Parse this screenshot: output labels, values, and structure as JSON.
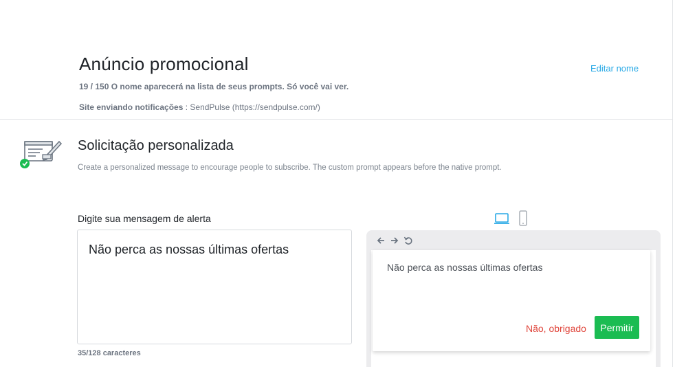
{
  "header": {
    "title": "Anúncio promocional",
    "edit_name": "Editar nome",
    "name_hint": "19 / 150 O nome aparecerá na lista de seus prompts. Só você vai ver.",
    "site_label": "Site enviando notificações",
    "site_value": ": SendPulse (https://sendpulse.com/)"
  },
  "section": {
    "title": "Solicitação personalizada",
    "description": "Create a personalized message to encourage people to subscribe. The custom prompt appears before the native prompt.",
    "icon": "custom-prompt-icon",
    "status_color": "#1bbc52"
  },
  "editor": {
    "label": "Digite sua mensagem de alerta",
    "message": "Não perca as nossas últimas ofertas",
    "char_count": "35/128 caracteres"
  },
  "preview": {
    "devices": [
      "desktop-icon",
      "mobile-icon"
    ],
    "selected_device": "desktop",
    "nav_icons": [
      "back-arrow-icon",
      "forward-arrow-icon",
      "reload-icon"
    ],
    "prompt_text": "Não perca as nossas últimas ofertas",
    "deny_label": "Não, obrigado",
    "allow_label": "Permitir"
  },
  "colors": {
    "accent": "#29a9e6",
    "allow": "#1bbc52",
    "deny": "#e0463c"
  }
}
